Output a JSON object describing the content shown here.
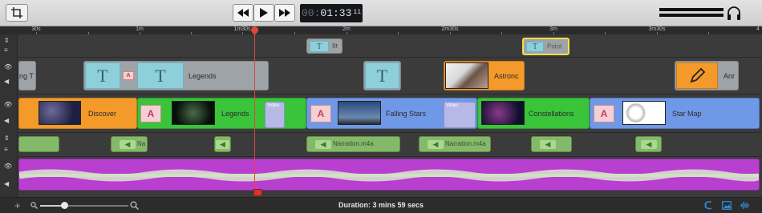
{
  "toolbar": {
    "timecode": {
      "dim": "00:",
      "main": "01:33",
      "frames": "11"
    },
    "buttons": {
      "crop": "crop-icon",
      "rewind": "rewind-icon",
      "play": "play-icon",
      "forward": "fast-forward-icon"
    }
  },
  "ruler": {
    "labels": [
      "30s",
      "1m",
      "1m30s",
      "2m",
      "2m30s",
      "3m",
      "3m30s",
      "4"
    ]
  },
  "tracks": {
    "titles_small": [
      {
        "label": "St"
      },
      {
        "label": "Point"
      }
    ],
    "titles_large": [
      {
        "label": "ng T"
      },
      {
        "label": "Legends"
      },
      {
        "label": "Astronc"
      },
      {
        "label": "Anr"
      }
    ],
    "video": [
      {
        "label": "Discover"
      },
      {
        "label": "Legends"
      },
      {
        "label": "Falling Stars"
      },
      {
        "label": "Constellations"
      },
      {
        "label": "Star Map"
      }
    ],
    "video_badges": [
      "Video",
      "Video"
    ],
    "audio": [
      {
        "label": "Na"
      },
      {
        "label": "Narration.m4a"
      },
      {
        "label": "Narration.m4a"
      }
    ]
  },
  "colors": {
    "title_clip": "#9ea3a8",
    "video_green": "#39c43a",
    "video_blue": "#6f99e6",
    "orange": "#f39a2a",
    "music": "#b93fd1",
    "playhead": "#e0453f"
  },
  "footer": {
    "duration": "Duration: 3 mins 59 secs"
  },
  "zoom": {
    "level": 0.27
  }
}
